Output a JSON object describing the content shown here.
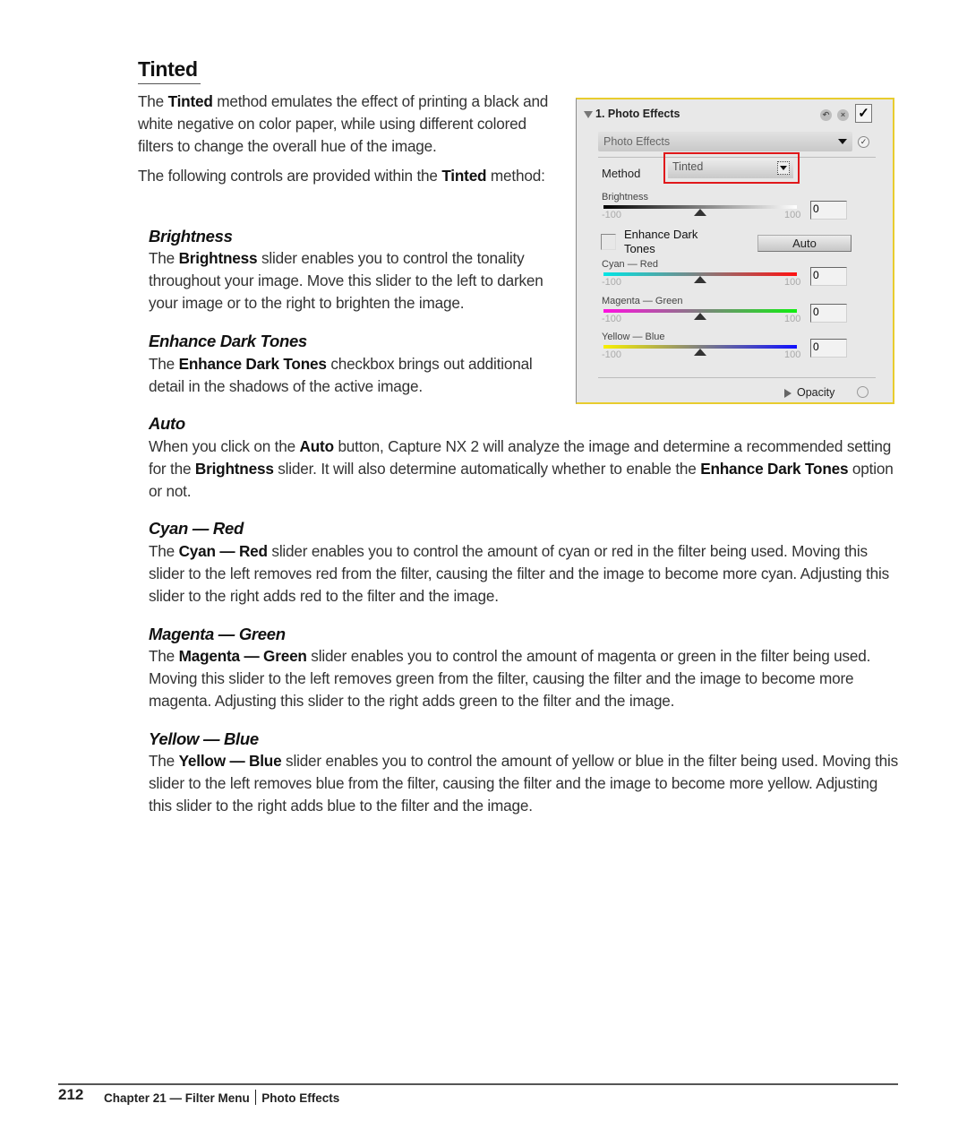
{
  "section": {
    "title": "Tinted",
    "intro": {
      "pre": "The ",
      "bold": "Tinted",
      "post": " method emulates the effect of printing a black and white negative on color paper, while using different colored filters to change the overall hue of the image."
    },
    "controls_intro": {
      "pre": "The following controls are provided within the ",
      "bold": "Tinted",
      "post": " method:"
    }
  },
  "subsections": [
    {
      "heading": "Brightness",
      "p1": "The ",
      "b1": "Brightness",
      "p2": " slider enables you to control the tonality throughout your image. Move this slider to the left to darken your image or to the right to brighten the image."
    },
    {
      "heading": "Enhance Dark Tones",
      "p1": "The ",
      "b1": "Enhance Dark Tones",
      "p2": " checkbox brings out additional detail in the shadows of the active image."
    },
    {
      "heading": "Auto",
      "p1": "When you click on the ",
      "b1": "Auto",
      "p2": " button, Capture NX 2 will analyze the image and determine a recommended setting for the ",
      "b2": "Brightness",
      "p3": " slider. It will also determine automatically whether to enable the ",
      "b3": "Enhance Dark Tones",
      "p4": " option or not."
    },
    {
      "heading": "Cyan — Red",
      "p1": "The ",
      "b1": "Cyan — Red",
      "p2": " slider enables you to control the amount of cyan or red in the filter being used. Moving this slider to the left removes red from the filter, causing the filter and the image to become more cyan. Adjusting this slider to the right adds red to the filter and the image."
    },
    {
      "heading": "Magenta — Green",
      "p1": "The ",
      "b1": "Magenta — Green",
      "p2": " slider enables you to control the amount of magenta or green in the filter being used. Moving this slider to the left removes green from the filter, causing the filter and the image to become more magenta. Adjusting this slider to the right adds green to the filter and the image."
    },
    {
      "heading": "Yellow — Blue",
      "p1": "The ",
      "b1": "Yellow — Blue",
      "p2": " slider enables you to control the amount of yellow or blue in the filter being used. Moving this slider to the left removes blue from the filter, causing the filter and the image to become more yellow. Adjusting this slider to the right adds blue to the filter and the image."
    }
  ],
  "panel": {
    "title": "1. Photo Effects",
    "reset_icon": "undo-icon",
    "delete_icon": "close-icon",
    "enable_check": "✓",
    "effect_dropdown": "Photo Effects",
    "method_label": "Method",
    "method_value": "Tinted",
    "highlight_color": "#e0181b",
    "sliders": [
      {
        "label": "Brightness",
        "min": "-100",
        "max": "100",
        "value": "0",
        "colors": [
          "#000000",
          "#ffffff"
        ]
      },
      {
        "label": "Cyan — Red",
        "min": "-100",
        "max": "100",
        "value": "0",
        "colors": [
          "#00e5e5",
          "#ff1010"
        ]
      },
      {
        "label": "Magenta — Green",
        "min": "-100",
        "max": "100",
        "value": "0",
        "colors": [
          "#ff10e0",
          "#10ee10"
        ]
      },
      {
        "label": "Yellow — Blue",
        "min": "-100",
        "max": "100",
        "value": "0",
        "colors": [
          "#f8f000",
          "#1010ff"
        ]
      }
    ],
    "enhance_label": "Enhance Dark Tones",
    "enhance_checked": false,
    "auto_label": "Auto",
    "opacity_label": "Opacity"
  },
  "footer": {
    "page_number": "212",
    "chapter": "Chapter 21 — Filter Menu",
    "section": "Photo Effects"
  }
}
